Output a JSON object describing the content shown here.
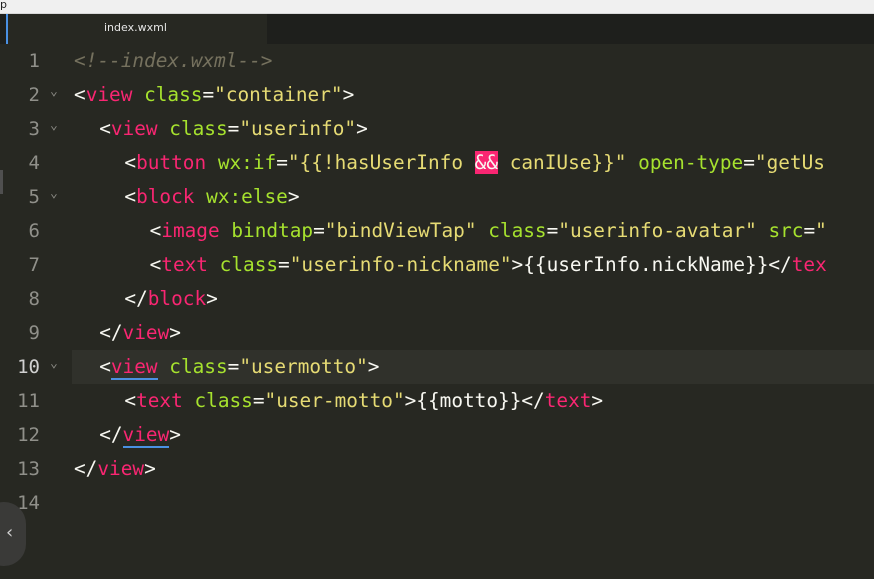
{
  "topstrip": {
    "text": "p"
  },
  "tabs": [
    {
      "label": "index.wxml",
      "active": true
    }
  ],
  "editor": {
    "active_line": 10,
    "lines": [
      {
        "n": "1",
        "indent": 0,
        "tokens": [
          {
            "t": "comment",
            "v": "<!--index.wxml-->"
          }
        ]
      },
      {
        "n": "2",
        "indent": 0,
        "fold": true,
        "tokens": [
          {
            "t": "punc",
            "v": "<"
          },
          {
            "t": "tag",
            "v": "view"
          },
          {
            "t": "punc",
            "v": " "
          },
          {
            "t": "attr",
            "v": "class"
          },
          {
            "t": "op",
            "v": "="
          },
          {
            "t": "str",
            "v": "\"container\""
          },
          {
            "t": "punc",
            "v": ">"
          }
        ]
      },
      {
        "n": "3",
        "indent": 2,
        "fold": true,
        "tokens": [
          {
            "t": "punc",
            "v": "<"
          },
          {
            "t": "tag",
            "v": "view"
          },
          {
            "t": "punc",
            "v": " "
          },
          {
            "t": "attr",
            "v": "class"
          },
          {
            "t": "op",
            "v": "="
          },
          {
            "t": "str",
            "v": "\"userinfo\""
          },
          {
            "t": "punc",
            "v": ">"
          }
        ]
      },
      {
        "n": "4",
        "indent": 4,
        "tokens": [
          {
            "t": "punc",
            "v": "<"
          },
          {
            "t": "tag",
            "v": "button"
          },
          {
            "t": "punc",
            "v": " "
          },
          {
            "t": "attr",
            "v": "wx:if"
          },
          {
            "t": "op",
            "v": "="
          },
          {
            "t": "str",
            "v": "\"{{!hasUserInfo "
          },
          {
            "t": "hl",
            "v": "&&"
          },
          {
            "t": "str",
            "v": " canIUse}}\""
          },
          {
            "t": "punc",
            "v": " "
          },
          {
            "t": "attr",
            "v": "open-type"
          },
          {
            "t": "op",
            "v": "="
          },
          {
            "t": "str",
            "v": "\"getUs"
          }
        ]
      },
      {
        "n": "5",
        "indent": 4,
        "fold": true,
        "tokens": [
          {
            "t": "punc",
            "v": "<"
          },
          {
            "t": "tag",
            "v": "block"
          },
          {
            "t": "punc",
            "v": " "
          },
          {
            "t": "attr",
            "v": "wx:else"
          },
          {
            "t": "punc",
            "v": ">"
          }
        ]
      },
      {
        "n": "6",
        "indent": 6,
        "tokens": [
          {
            "t": "punc",
            "v": "<"
          },
          {
            "t": "tag",
            "v": "image"
          },
          {
            "t": "punc",
            "v": " "
          },
          {
            "t": "attr",
            "v": "bindtap"
          },
          {
            "t": "op",
            "v": "="
          },
          {
            "t": "str",
            "v": "\"bindViewTap\""
          },
          {
            "t": "punc",
            "v": " "
          },
          {
            "t": "attr",
            "v": "class"
          },
          {
            "t": "op",
            "v": "="
          },
          {
            "t": "str",
            "v": "\"userinfo-avatar\""
          },
          {
            "t": "punc",
            "v": " "
          },
          {
            "t": "attr",
            "v": "src"
          },
          {
            "t": "op",
            "v": "="
          },
          {
            "t": "str",
            "v": "\""
          }
        ]
      },
      {
        "n": "7",
        "indent": 6,
        "tokens": [
          {
            "t": "punc",
            "v": "<"
          },
          {
            "t": "tag",
            "v": "text"
          },
          {
            "t": "punc",
            "v": " "
          },
          {
            "t": "attr",
            "v": "class"
          },
          {
            "t": "op",
            "v": "="
          },
          {
            "t": "str",
            "v": "\"userinfo-nickname\""
          },
          {
            "t": "punc",
            "v": ">{{userInfo.nickName}}</"
          },
          {
            "t": "tag",
            "v": "tex"
          }
        ]
      },
      {
        "n": "8",
        "indent": 4,
        "tokens": [
          {
            "t": "punc",
            "v": "</"
          },
          {
            "t": "tag",
            "v": "block"
          },
          {
            "t": "punc",
            "v": ">"
          }
        ]
      },
      {
        "n": "9",
        "indent": 2,
        "tokens": [
          {
            "t": "punc",
            "v": "</"
          },
          {
            "t": "tag",
            "v": "view"
          },
          {
            "t": "punc",
            "v": ">"
          }
        ]
      },
      {
        "n": "10",
        "indent": 2,
        "fold": true,
        "tokens": [
          {
            "t": "punc",
            "v": "<"
          },
          {
            "t": "tagmatch",
            "v": "view"
          },
          {
            "t": "punc",
            "v": " "
          },
          {
            "t": "attr",
            "v": "class"
          },
          {
            "t": "op",
            "v": "="
          },
          {
            "t": "str",
            "v": "\"usermotto\""
          },
          {
            "t": "punc",
            "v": ">"
          }
        ]
      },
      {
        "n": "11",
        "indent": 4,
        "tokens": [
          {
            "t": "punc",
            "v": "<"
          },
          {
            "t": "tag",
            "v": "text"
          },
          {
            "t": "punc",
            "v": " "
          },
          {
            "t": "attr",
            "v": "class"
          },
          {
            "t": "op",
            "v": "="
          },
          {
            "t": "str",
            "v": "\"user-motto\""
          },
          {
            "t": "punc",
            "v": ">{{motto}}</"
          },
          {
            "t": "tag",
            "v": "text"
          },
          {
            "t": "punc",
            "v": ">"
          }
        ]
      },
      {
        "n": "12",
        "indent": 2,
        "tokens": [
          {
            "t": "punc",
            "v": "</"
          },
          {
            "t": "tagmatch",
            "v": "view"
          },
          {
            "t": "punc",
            "v": ">"
          }
        ]
      },
      {
        "n": "13",
        "indent": 0,
        "tokens": [
          {
            "t": "punc",
            "v": "</"
          },
          {
            "t": "tag",
            "v": "view"
          },
          {
            "t": "punc",
            "v": ">"
          }
        ]
      },
      {
        "n": "14",
        "indent": 0,
        "tokens": []
      }
    ]
  },
  "side_handle": {
    "icon": "chevron-left-icon",
    "glyph": "‹"
  },
  "colors": {
    "background": "#272822",
    "comment": "#75715e",
    "tag": "#f92672",
    "attribute": "#a6e22e",
    "string": "#e6db74",
    "text": "#f8f8f2",
    "bracket_match": "#4a90e2"
  }
}
